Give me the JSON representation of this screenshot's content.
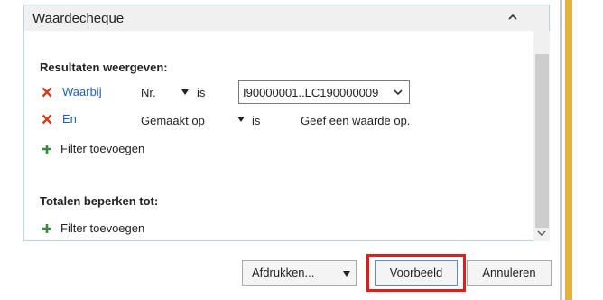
{
  "panel": {
    "title": "Waardecheque",
    "collapse_icon": "chevron-up-icon"
  },
  "results": {
    "heading": "Resultaten weergeven:",
    "filters": [
      {
        "conjunction": "Waarbij",
        "field": "Nr.",
        "operator": "is",
        "value": "I90000001..LC190000009",
        "remove_icon": "close-icon"
      },
      {
        "conjunction": "En",
        "field": "Gemaakt op",
        "operator": "is",
        "value": "Geef een waarde op.",
        "remove_icon": "close-icon"
      }
    ],
    "add_filter": "Filter toevoegen"
  },
  "totals": {
    "heading": "Totalen beperken tot:",
    "add_filter": "Filter toevoegen"
  },
  "buttons": {
    "print": "Afdrukken...",
    "preview": "Voorbeeld",
    "cancel": "Annuleren"
  },
  "colors": {
    "link": "#1f5fb7",
    "remove_icon": "#d43c1c",
    "add_icon": "#3b8a3b",
    "highlight": "#e41b1b",
    "side_strip": "#e3b13e"
  }
}
